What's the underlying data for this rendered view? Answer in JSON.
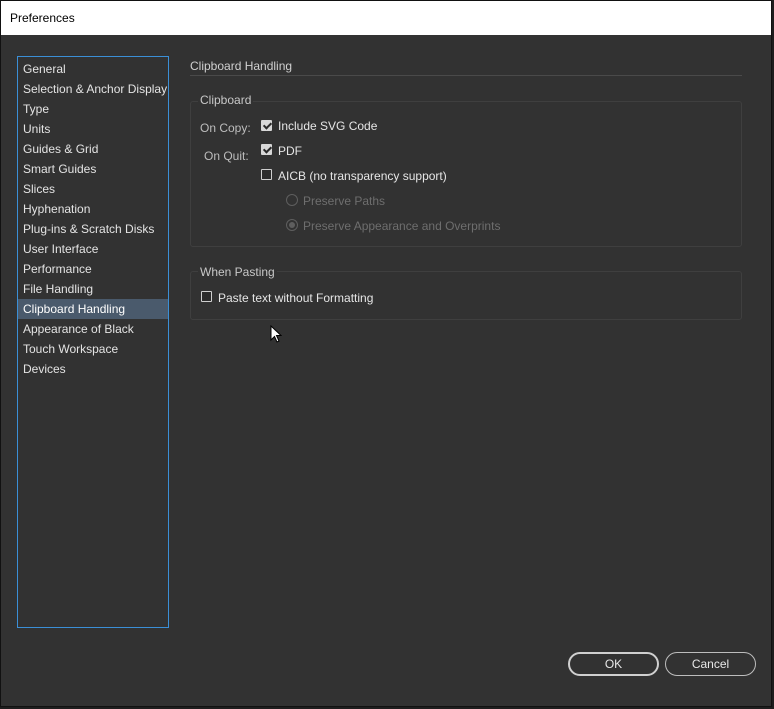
{
  "window": {
    "title": "Preferences"
  },
  "sidebar": {
    "items": [
      {
        "label": "General"
      },
      {
        "label": "Selection & Anchor Display"
      },
      {
        "label": "Type"
      },
      {
        "label": "Units"
      },
      {
        "label": "Guides & Grid"
      },
      {
        "label": "Smart Guides"
      },
      {
        "label": "Slices"
      },
      {
        "label": "Hyphenation"
      },
      {
        "label": "Plug-ins & Scratch Disks"
      },
      {
        "label": "User Interface"
      },
      {
        "label": "Performance"
      },
      {
        "label": "File Handling"
      },
      {
        "label": "Clipboard Handling"
      },
      {
        "label": "Appearance of Black"
      },
      {
        "label": "Touch Workspace"
      },
      {
        "label": "Devices"
      }
    ],
    "selected": "Clipboard Handling"
  },
  "panel": {
    "title": "Clipboard Handling",
    "clipboard": {
      "group_label": "Clipboard",
      "on_copy_label": "On Copy:",
      "on_quit_label": "On Quit:",
      "include_svg": {
        "label": "Include SVG Code",
        "checked": true
      },
      "pdf": {
        "label": "PDF",
        "checked": true
      },
      "aicb": {
        "label": "AICB (no transparency support)",
        "checked": false
      },
      "preserve_paths": {
        "label": "Preserve Paths",
        "selected": false,
        "enabled": false
      },
      "preserve_appearance": {
        "label": "Preserve Appearance and Overprints",
        "selected": true,
        "enabled": false
      }
    },
    "pasting": {
      "group_label": "When Pasting",
      "paste_without_formatting": {
        "label": "Paste text without Formatting",
        "checked": false
      }
    }
  },
  "buttons": {
    "ok": "OK",
    "cancel": "Cancel"
  }
}
